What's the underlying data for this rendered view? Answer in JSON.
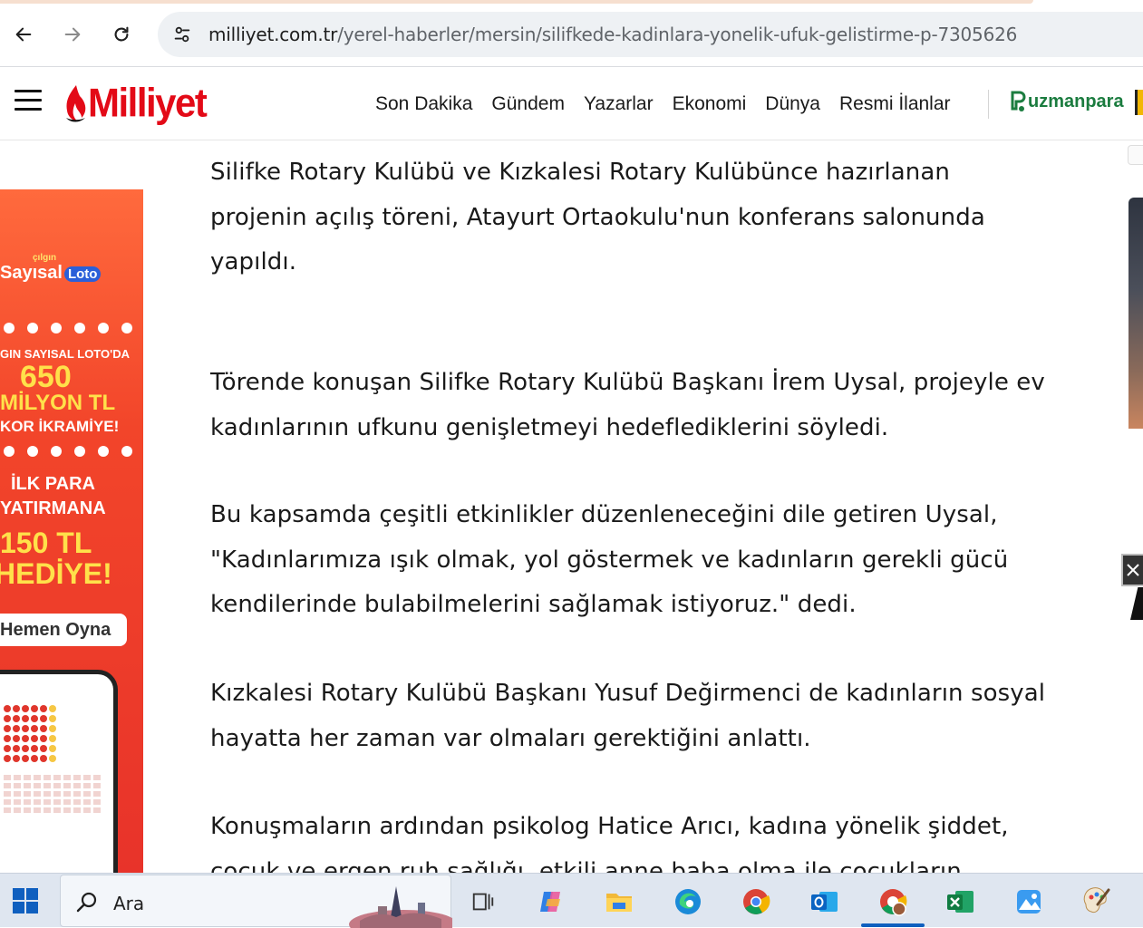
{
  "browser": {
    "url_domain": "milliyet.com.tr",
    "url_path": "/yerel-haberler/mersin/silifkede-kadinlara-yonelik-ufuk-gelistirme-p-7305626"
  },
  "header": {
    "logo_text": "Milliyet",
    "nav": [
      "Son Dakika",
      "Gündem",
      "Yazarlar",
      "Ekonomi",
      "Dünya",
      "Resmi İlanlar"
    ],
    "partner_logo": "uzmanpara"
  },
  "left_ad": {
    "brand_small": "çılgın",
    "brand_main": "Sayısal",
    "brand_badge": "Loto",
    "line1": "GIN SAYISAL LOTO'DA",
    "line2": "650",
    "line3": "MİLYON TL",
    "line4": "KOR İKRAMİYE!",
    "line5": "İLK PARA",
    "line6": "YATIRMANA",
    "line7": "150 TL",
    "line8": "HEDİYE!",
    "button": "Hemen Oyna"
  },
  "article": {
    "paragraphs": [
      "Silifke Rotary Kulübü ve Kızkalesi Rotary Kulübünce hazırlanan projenin açılış töreni, Atayurt Ortaokulu'nun konferans salonunda yapıldı.",
      "Törende konuşan Silifke Rotary Kulübü Başkanı İrem Uysal, projeyle ev kadınlarının ufkunu genişletmeyi hedeflediklerini söyledi.",
      "Bu kapsamda çeşitli etkinlikler düzenleneceğini dile getiren Uysal, \"Kadınlarımıza ışık olmak, yol göstermek ve kadınların gerekli gücü kendilerinde bulabilmelerini sağlamak istiyoruz.\" dedi.",
      "Kızkalesi Rotary Kulübü Başkanı Yusuf Değirmenci de kadınların sosyal hayatta her zaman var olmaları gerektiğini anlattı.",
      "Konuşmaların ardından psikolog Hatice Arıcı, kadına yönelik şiddet, çocuk ve ergen ruh sağlığı, etkili anne baba olma ile çocukların"
    ]
  },
  "taskbar": {
    "search_placeholder": "Ara",
    "apps": [
      "task-view",
      "copilot",
      "file-explorer",
      "edge",
      "chrome",
      "outlook",
      "chrome-profile",
      "excel",
      "photos",
      "paint"
    ]
  },
  "colors": {
    "brand_red": "#e30a17",
    "uzmanpara_green": "#1b7c3f",
    "ad_red": "#e8332a",
    "taskbar_bg": "#dfe6f0"
  }
}
